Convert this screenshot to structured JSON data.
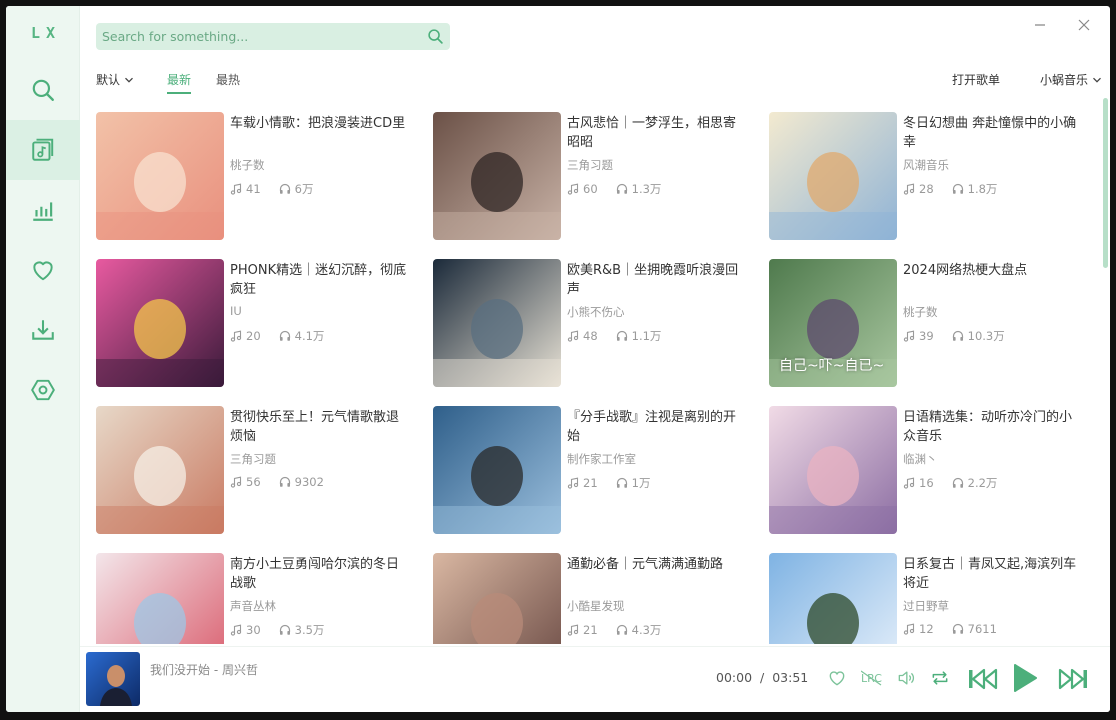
{
  "app": {
    "logo": "LX"
  },
  "search": {
    "placeholder": "Search for something..."
  },
  "filters": {
    "sort_label": "默认",
    "tabs": [
      "最新",
      "最热"
    ],
    "open_playlist": "打开歌单",
    "source_label": "小蜗音乐"
  },
  "playlists": [
    {
      "title": "车载小情歌：把浪漫装进CD里",
      "author": "桃子数",
      "songs": "41",
      "plays": "6万"
    },
    {
      "title": "古风悲恰｜一梦浮生，相思寄昭昭",
      "author": "三角习题",
      "songs": "60",
      "plays": "1.3万"
    },
    {
      "title": "冬日幻想曲 奔赴憧憬中的小确幸",
      "author": "风潮音乐",
      "songs": "28",
      "plays": "1.8万"
    },
    {
      "title": "PHONK精选｜迷幻沉醉，彻底疯狂",
      "author": "IU",
      "songs": "20",
      "plays": "4.1万"
    },
    {
      "title": "欧美R&B｜坐拥晚霞听浪漫回声",
      "author": "小熊不伤心",
      "songs": "48",
      "plays": "1.1万"
    },
    {
      "title": "2024网络热梗大盘点",
      "author": "桃子数",
      "songs": "39",
      "plays": "10.3万",
      "cover_text": "自己~吓~自已~"
    },
    {
      "title": "贯彻快乐至上！元气情歌散退烦恼",
      "author": "三角习题",
      "songs": "56",
      "plays": "9302"
    },
    {
      "title": "『分手战歌』注视是离别的开始",
      "author": "制作家工作室",
      "songs": "21",
      "plays": "1万"
    },
    {
      "title": "日语精选集：动听亦冷门的小众音乐",
      "author": "临渊丶",
      "songs": "16",
      "plays": "2.2万"
    },
    {
      "title": "南方小土豆勇闯哈尔滨的冬日战歌",
      "author": "声音丛林",
      "songs": "30",
      "plays": "3.5万"
    },
    {
      "title": "通勤必备｜元气满满通勤路",
      "author": "小酷星发现",
      "songs": "21",
      "plays": "4.3万"
    },
    {
      "title": "日系复古｜青凤又起,海滨列车将近",
      "author": "过日野草",
      "songs": "12",
      "plays": "7611"
    }
  ],
  "player": {
    "song": "我们没开始 - 周兴哲",
    "current_time": "00:00",
    "total_time": "03:51",
    "time_separator": "/"
  },
  "colors": {
    "accent": "#4caf7b",
    "sidebar_bg": "#edf7f1",
    "search_bg": "#d9efe2"
  }
}
